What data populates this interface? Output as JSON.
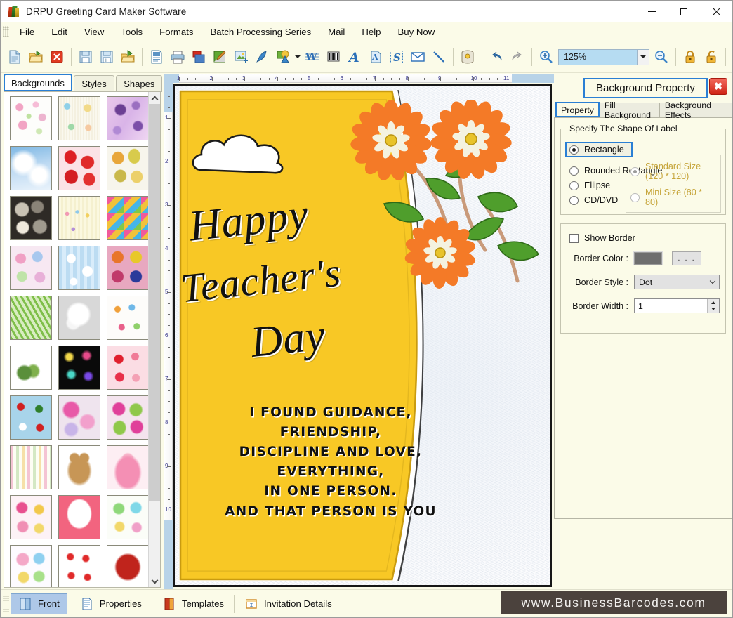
{
  "window": {
    "title": "DRPU Greeting Card Maker Software",
    "app_icon": "books-icon",
    "minimize": "minimize-icon",
    "maximize": "maximize-icon",
    "close": "close-icon"
  },
  "menubar": {
    "items": [
      {
        "label": "File"
      },
      {
        "label": "Edit"
      },
      {
        "label": "View"
      },
      {
        "label": "Tools"
      },
      {
        "label": "Formats"
      },
      {
        "label": "Batch Processing Series"
      },
      {
        "label": "Mail"
      },
      {
        "label": "Help"
      },
      {
        "label": "Buy Now"
      }
    ]
  },
  "toolbar": {
    "zoom_value": "125%",
    "buttons": [
      {
        "name": "new-document-icon"
      },
      {
        "name": "open-folder-icon"
      },
      {
        "name": "close-document-icon"
      },
      {
        "name": "save-icon"
      },
      {
        "name": "save-as-icon"
      },
      {
        "name": "export-folder-icon"
      },
      {
        "name": "page-setup-icon"
      },
      {
        "name": "print-icon"
      },
      {
        "name": "print-preview-icon"
      },
      {
        "name": "background-image-icon"
      },
      {
        "name": "insert-picture-icon"
      },
      {
        "name": "pen-tool-icon"
      },
      {
        "name": "shape-tool-icon"
      },
      {
        "name": "watermark-icon"
      },
      {
        "name": "barcode-icon"
      },
      {
        "name": "text-tool-icon"
      },
      {
        "name": "text-art-icon"
      },
      {
        "name": "signature-icon"
      },
      {
        "name": "envelope-icon"
      },
      {
        "name": "line-tool-icon"
      },
      {
        "name": "database-icon"
      },
      {
        "name": "undo-icon"
      },
      {
        "name": "redo-icon"
      },
      {
        "name": "zoom-in-icon"
      },
      {
        "name": "zoom-out-icon"
      },
      {
        "name": "lock-icon"
      },
      {
        "name": "unlock-icon"
      },
      {
        "name": "align-left-icon"
      },
      {
        "name": "align-center-horizontal-icon"
      },
      {
        "name": "align-right-icon"
      },
      {
        "name": "align-top-icon"
      },
      {
        "name": "align-center-vertical-icon"
      },
      {
        "name": "align-bottom-icon"
      }
    ]
  },
  "left_panel": {
    "tabs": [
      {
        "label": "Backgrounds",
        "active": true
      },
      {
        "label": "Styles",
        "active": false
      },
      {
        "label": "Shapes",
        "active": false
      }
    ],
    "thumbnails": [
      {
        "name": "thumb-baby-pink-doodles"
      },
      {
        "name": "thumb-baby-shower-pastel"
      },
      {
        "name": "thumb-purple-floral-burst"
      },
      {
        "name": "thumb-blue-clouds-sky"
      },
      {
        "name": "thumb-red-strawberries"
      },
      {
        "name": "thumb-autumn-leaves"
      },
      {
        "name": "thumb-grey-pebbles"
      },
      {
        "name": "thumb-cream-confetti-stripes"
      },
      {
        "name": "thumb-colorful-gift-boxes"
      },
      {
        "name": "thumb-pastel-flower-circles"
      },
      {
        "name": "thumb-blue-snowflakes"
      },
      {
        "name": "thumb-pink-mandala-squares"
      },
      {
        "name": "thumb-green-pine-trees"
      },
      {
        "name": "thumb-white-heart-petals"
      },
      {
        "name": "thumb-kids-toys-pattern"
      },
      {
        "name": "thumb-green-leaf-pendant"
      },
      {
        "name": "thumb-black-fireworks"
      },
      {
        "name": "thumb-red-hearts"
      },
      {
        "name": "thumb-santa-christmas"
      },
      {
        "name": "thumb-pink-bokeh-circles"
      },
      {
        "name": "thumb-pink-green-flowers"
      },
      {
        "name": "thumb-pastel-stripes"
      },
      {
        "name": "thumb-teddy-bear"
      },
      {
        "name": "thumb-pink-princess-dress"
      },
      {
        "name": "thumb-pink-hearts-balloons"
      },
      {
        "name": "thumb-heart-frame-bears"
      },
      {
        "name": "thumb-easter-bunnies"
      },
      {
        "name": "thumb-rainbow-kids-party"
      },
      {
        "name": "thumb-white-red-ribbons"
      },
      {
        "name": "thumb-red-hibiscus-flower"
      }
    ]
  },
  "canvas": {
    "ruler_h_labels": [
      "1",
      "2",
      "3",
      "4",
      "5",
      "6",
      "7",
      "8",
      "9",
      "10",
      "11"
    ],
    "ruler_v_labels": [
      "1",
      "2",
      "3",
      "4",
      "5",
      "6",
      "7",
      "8",
      "9",
      "10"
    ],
    "card": {
      "title_lines": [
        "Happy",
        "Teacher's",
        "Day"
      ],
      "verse_lines": [
        "I FOUND GUIDANCE,",
        "FRIENDSHIP,",
        "DISCIPLINE AND LOVE,",
        "EVERYTHING,",
        "IN ONE PERSON.",
        "AND THAT PERSON IS YOU"
      ],
      "colors": {
        "panel_yellow": "#f8c825",
        "flower_orange": "#f47a27",
        "flower_center": "#e8c32a",
        "leaf_green": "#4f9e2c",
        "text_black": "#101010"
      }
    }
  },
  "right_panel": {
    "title": "Background Property",
    "close_label": "✖",
    "tabs": [
      {
        "label": "Property",
        "active": true
      },
      {
        "label": "Fill Background",
        "active": false
      },
      {
        "label": "Background Effects",
        "active": false
      }
    ],
    "shape_group": {
      "legend": "Specify The Shape Of Label",
      "options": [
        {
          "label": "Rectangle",
          "selected": true,
          "enabled": true
        },
        {
          "label": "Rounded Rectangle",
          "selected": false,
          "enabled": true
        },
        {
          "label": "Ellipse",
          "selected": false,
          "enabled": true
        },
        {
          "label": "CD/DVD",
          "selected": false,
          "enabled": true
        }
      ],
      "size_options": [
        {
          "label": "Standard Size (120 * 120)",
          "selected": true,
          "enabled": false
        },
        {
          "label": "Mini Size (80 * 80)",
          "selected": false,
          "enabled": false
        }
      ]
    },
    "border_group": {
      "show_border_label": "Show Border",
      "show_border_checked": false,
      "border_color_label": "Border Color :",
      "border_color_value": "#6e6e6e",
      "browse_label": ". . .",
      "border_style_label": "Border Style :",
      "border_style_value": "Dot",
      "border_width_label": "Border Width :",
      "border_width_value": "1"
    }
  },
  "statusbar": {
    "items": [
      {
        "label": "Front",
        "icon": "front-page-icon",
        "active": true
      },
      {
        "label": "Properties",
        "icon": "properties-icon",
        "active": false
      },
      {
        "label": "Templates",
        "icon": "templates-icon",
        "active": false
      },
      {
        "label": "Invitation Details",
        "icon": "invitation-details-icon",
        "active": false
      }
    ],
    "brand": "www.BusinessBarcodes.com"
  }
}
